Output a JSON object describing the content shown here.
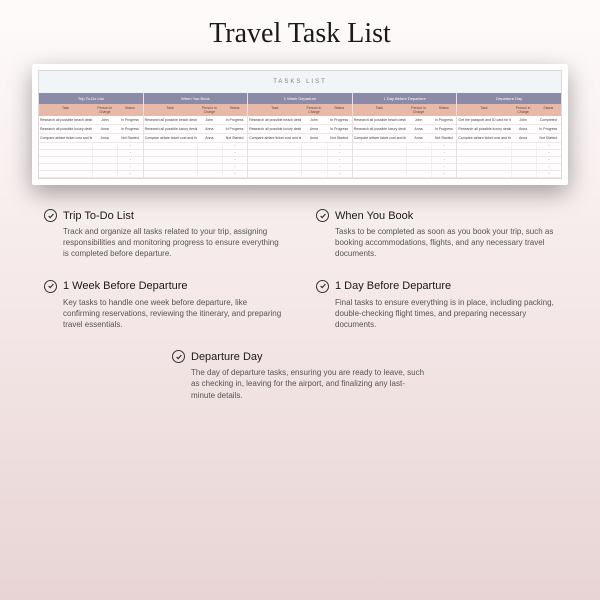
{
  "title": "Travel Task List",
  "sheet": {
    "header": "TASKS LIST",
    "subheads": {
      "task": "Task",
      "who": "Person in Charge",
      "status": "Status"
    },
    "columns": [
      {
        "name": "Trip To-Do List",
        "rows": [
          {
            "task": "Research all possible beach destinations",
            "who": "John",
            "status": "In Progress"
          },
          {
            "task": "Research all possible luxury destinations",
            "who": "Anna",
            "status": "In Progress"
          },
          {
            "task": "Compare airfare ticket cost and times",
            "who": "Anna",
            "status": "Not Started"
          }
        ]
      },
      {
        "name": "When You Book",
        "rows": [
          {
            "task": "Research all possible beach destinations",
            "who": "John",
            "status": "In Progress"
          },
          {
            "task": "Research all possible luxury destinations",
            "who": "Anna",
            "status": "In Progress"
          },
          {
            "task": "Compare airfare ticket cost and times",
            "who": "Anna",
            "status": "Not Started"
          }
        ]
      },
      {
        "name": "1 Week Departure",
        "rows": [
          {
            "task": "Research all possible beach destinations",
            "who": "John",
            "status": "In Progress"
          },
          {
            "task": "Research all possible luxury destinations",
            "who": "Anna",
            "status": "In Progress"
          },
          {
            "task": "Compare airfare ticket cost and times",
            "who": "Anna",
            "status": "Not Started"
          }
        ]
      },
      {
        "name": "1 Day Before Departure",
        "rows": [
          {
            "task": "Research all possible beach destinations",
            "who": "John",
            "status": "In Progress"
          },
          {
            "task": "Research all possible luxury destinations",
            "who": "Anna",
            "status": "In Progress"
          },
          {
            "task": "Compare airfare ticket cost and times",
            "who": "Anna",
            "status": "Not Started"
          }
        ]
      },
      {
        "name": "Departure Day",
        "rows": [
          {
            "task": "Get the passport and ID card for the trip",
            "who": "John",
            "status": "Completed"
          },
          {
            "task": "Research all possible luxury destinations",
            "who": "Anna",
            "status": "In Progress"
          },
          {
            "task": "Compare airfare ticket cost and times",
            "who": "Anna",
            "status": "Not Started"
          }
        ]
      }
    ]
  },
  "features": [
    {
      "title": "Trip To-Do List",
      "desc": "Track and organize all tasks related to your trip, assigning responsibilities and monitoring progress to ensure everything is completed before departure."
    },
    {
      "title": "When You Book",
      "desc": "Tasks to be completed as soon as you book your trip, such as booking accommodations, flights, and any necessary travel documents."
    },
    {
      "title": "1 Week Before Departure",
      "desc": "Key tasks to handle one week before departure, like confirming reservations, reviewing the itinerary, and preparing travel essentials."
    },
    {
      "title": "1 Day Before Departure",
      "desc": "Final tasks to ensure everything is in place, including packing, double-checking flight times, and preparing necessary documents."
    },
    {
      "title": "Departure Day",
      "desc": "The day of departure tasks, ensuring you are ready to leave, such as checking in, leaving for the airport, and finalizing any last-minute details."
    }
  ]
}
